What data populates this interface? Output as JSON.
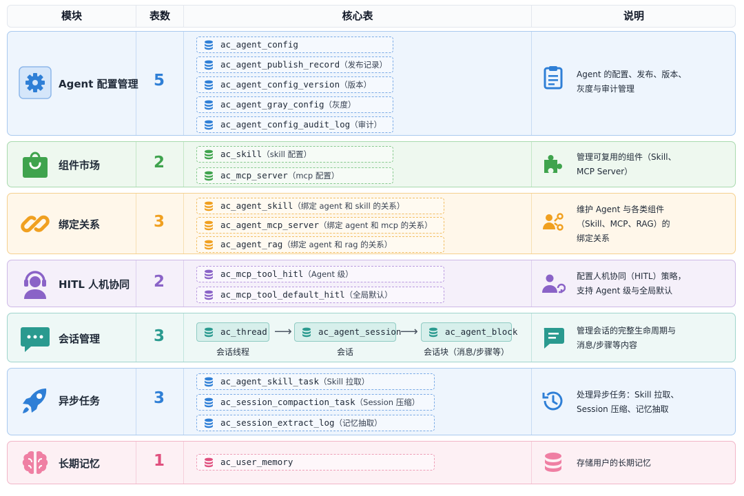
{
  "header": {
    "module": "模块",
    "count": "表数",
    "tables": "核心表",
    "desc": "说明"
  },
  "rows": [
    {
      "name": "Agent 配置管理",
      "count": "5",
      "tables": [
        {
          "t": "ac_agent_config",
          "n": ""
        },
        {
          "t": "ac_agent_publish_record",
          "n": "（发布记录）"
        },
        {
          "t": "ac_agent_config_version",
          "n": "（版本）"
        },
        {
          "t": "ac_agent_gray_config",
          "n": "（灰度）"
        },
        {
          "t": "ac_agent_config_audit_log",
          "n": "（审计）"
        }
      ],
      "desc": [
        "Agent 的配置、发布、版本、",
        "灰度与审计管理"
      ]
    },
    {
      "name": "组件市场",
      "count": "2",
      "tables": [
        {
          "t": "ac_skill",
          "n": "（skill 配置）"
        },
        {
          "t": "ac_mcp_server",
          "n": "（mcp 配置）"
        }
      ],
      "desc": [
        "管理可复用的组件（Skill、",
        "MCP Server）"
      ]
    },
    {
      "name": "绑定关系",
      "count": "3",
      "tables": [
        {
          "t": "ac_agent_skill",
          "n": "（绑定 agent 和 skill 的关系）"
        },
        {
          "t": "ac_agent_mcp_server",
          "n": "（绑定 agent 和 mcp 的关系）"
        },
        {
          "t": "ac_agent_rag",
          "n": "（绑定 agent 和 rag 的关系）"
        }
      ],
      "desc": [
        "维护 Agent 与各类组件",
        "（Skill、MCP、RAG）的",
        "绑定关系"
      ]
    },
    {
      "name": "HITL 人机协同",
      "count": "2",
      "tables": [
        {
          "t": "ac_mcp_tool_hitl",
          "n": "（Agent 级）"
        },
        {
          "t": "ac_mcp_tool_default_hitl",
          "n": "（全局默认）"
        }
      ],
      "desc": [
        "配置人机协同（HITL）策略，",
        "支持 Agent 级与全局默认"
      ]
    },
    {
      "name": "会话管理",
      "count": "3",
      "flow": [
        {
          "t": "ac_thread",
          "label": "会话线程"
        },
        {
          "t": "ac_agent_session",
          "label": "会话"
        },
        {
          "t": "ac_agent_block",
          "label": "会话块（消息/步骤等）"
        }
      ],
      "desc": [
        "管理会话的完整生命周期与",
        "消息/步骤等内容"
      ]
    },
    {
      "name": "异步任务",
      "count": "3",
      "tables": [
        {
          "t": "ac_agent_skill_task",
          "n": "（Skill 拉取）"
        },
        {
          "t": "ac_session_compaction_task",
          "n": "（Session 压缩）"
        },
        {
          "t": "ac_session_extract_log",
          "n": "（记忆抽取）"
        }
      ],
      "desc": [
        "处理异步任务：Skill 拉取、",
        "Session 压缩、记忆抽取"
      ]
    },
    {
      "name": "长期记忆",
      "count": "1",
      "tables": [
        {
          "t": "ac_user_memory",
          "n": ""
        }
      ],
      "desc": [
        "存储用户的长期记忆"
      ]
    }
  ],
  "colors": {
    "blue": "#2f7fd6",
    "green": "#3fa34d",
    "orange": "#f0a020",
    "purple": "#8a63c7",
    "teal": "#2a9a8f",
    "pink": "#e0507e"
  }
}
